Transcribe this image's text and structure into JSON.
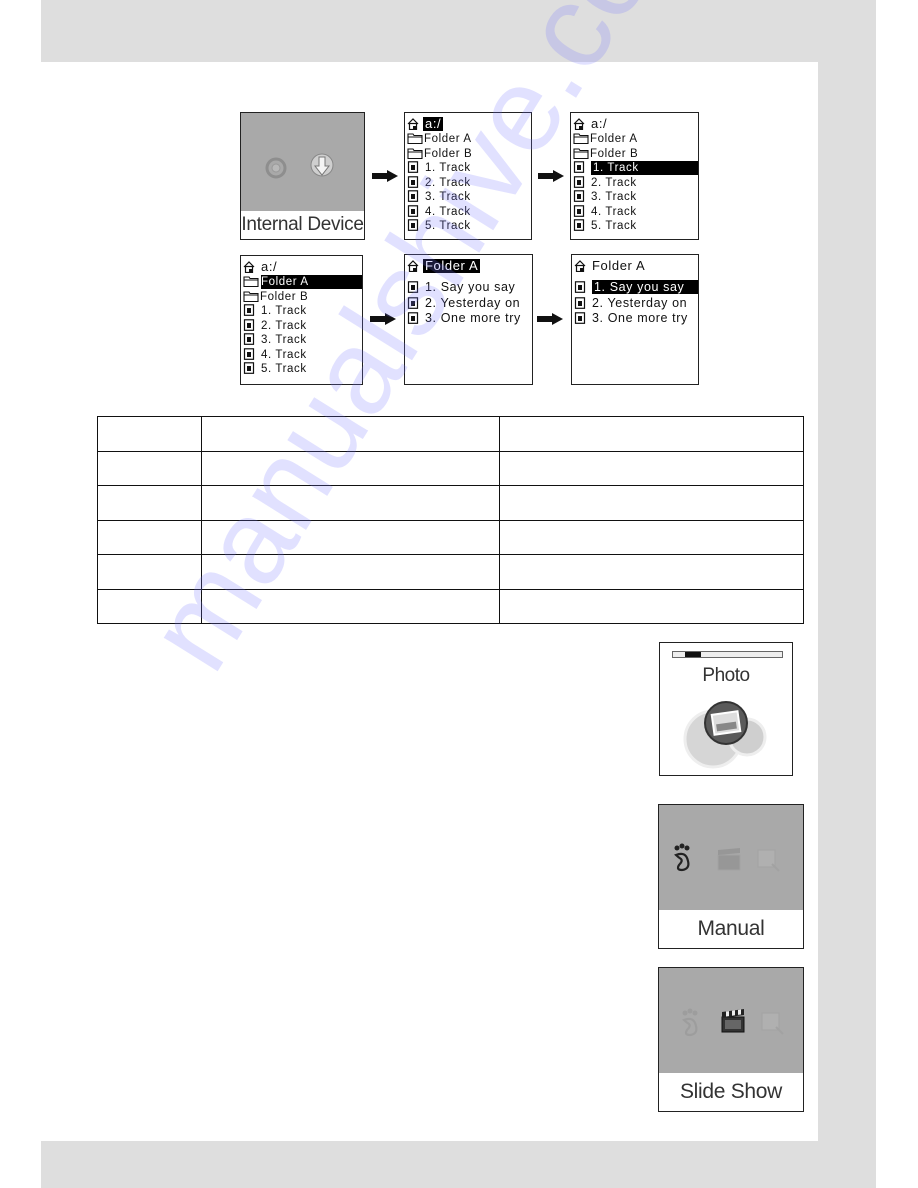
{
  "watermark": "manualshive.com",
  "screens_row1": {
    "internal_device": {
      "caption": "Internal Device",
      "icons": [
        "sync-icon",
        "download-arrow-icon"
      ]
    },
    "root_browser": {
      "path": "a:/",
      "path_selected": true,
      "items": [
        {
          "type": "folder",
          "label": "Folder A",
          "selected": false
        },
        {
          "type": "folder",
          "label": "Folder B",
          "selected": false
        },
        {
          "type": "file",
          "label": "1. Track",
          "selected": false
        },
        {
          "type": "file",
          "label": "2. Track",
          "selected": false
        },
        {
          "type": "file",
          "label": "3. Track",
          "selected": false
        },
        {
          "type": "file",
          "label": "4. Track",
          "selected": false
        },
        {
          "type": "file",
          "label": "5. Track",
          "selected": false
        }
      ]
    },
    "root_browser_track_selected": {
      "path": "a:/",
      "path_selected": false,
      "items": [
        {
          "type": "folder",
          "label": "Folder A",
          "selected": false
        },
        {
          "type": "folder",
          "label": "Folder B",
          "selected": false
        },
        {
          "type": "file",
          "label": "1. Track",
          "selected": true
        },
        {
          "type": "file",
          "label": "2. Track",
          "selected": false
        },
        {
          "type": "file",
          "label": "3. Track",
          "selected": false
        },
        {
          "type": "file",
          "label": "4. Track",
          "selected": false
        },
        {
          "type": "file",
          "label": "5. Track",
          "selected": false
        }
      ]
    }
  },
  "screens_row2": {
    "root_browser_folder_selected": {
      "path": "a:/",
      "path_selected": false,
      "items": [
        {
          "type": "folder",
          "label": "Folder A",
          "selected": true
        },
        {
          "type": "folder",
          "label": "Folder B",
          "selected": false
        },
        {
          "type": "file",
          "label": "1. Track",
          "selected": false
        },
        {
          "type": "file",
          "label": "2. Track",
          "selected": false
        },
        {
          "type": "file",
          "label": "3. Track",
          "selected": false
        },
        {
          "type": "file",
          "label": "4. Track",
          "selected": false
        },
        {
          "type": "file",
          "label": "5. Track",
          "selected": false
        }
      ]
    },
    "folder_a_browser": {
      "path": "Folder A",
      "path_selected": true,
      "items": [
        {
          "type": "file",
          "label": "1. Say you say",
          "selected": false
        },
        {
          "type": "file",
          "label": "2. Yesterday on",
          "selected": false
        },
        {
          "type": "file",
          "label": "3. One more try",
          "selected": false
        }
      ]
    },
    "folder_a_browser_track_selected": {
      "path": "Folder A",
      "path_selected": false,
      "items": [
        {
          "type": "file",
          "label": "1. Say you say",
          "selected": true
        },
        {
          "type": "file",
          "label": "2. Yesterday on",
          "selected": false
        },
        {
          "type": "file",
          "label": "3. One more try",
          "selected": false
        }
      ]
    }
  },
  "table": {
    "rows": [
      [
        "",
        "",
        ""
      ],
      [
        "",
        "",
        ""
      ],
      [
        "",
        "",
        ""
      ],
      [
        "",
        "",
        ""
      ],
      [
        "",
        "",
        ""
      ],
      [
        "",
        "",
        ""
      ]
    ]
  },
  "photo_screen": {
    "title": "Photo",
    "progress": 0.15
  },
  "manual_screen": {
    "caption": "Manual",
    "active_icon": "footprint-icon"
  },
  "slideshow_screen": {
    "caption": "Slide Show",
    "active_icon": "clapperboard-icon"
  }
}
